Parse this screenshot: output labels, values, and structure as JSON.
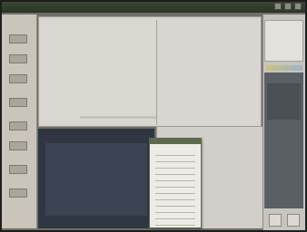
{
  "window": {
    "title": "",
    "controls": [
      "minimize-icon",
      "maximize-icon",
      "close-icon"
    ]
  },
  "toolbar": {
    "tools": [
      "tool-1-icon",
      "tool-2-icon",
      "tool-3-icon",
      "tool-4-icon",
      "tool-5-icon",
      "tool-6-icon",
      "tool-7-icon",
      "tool-8-icon"
    ]
  },
  "dialog": {
    "title": "",
    "rows": [
      "",
      "",
      "",
      "",
      "",
      "",
      "",
      "",
      "",
      "",
      "",
      ""
    ]
  },
  "colors": {
    "titlebar": "#2c3526",
    "workspace": "#d7d4cf",
    "dark_canvas": "#2f3742",
    "dialog_accent": "#5e6a4c"
  }
}
